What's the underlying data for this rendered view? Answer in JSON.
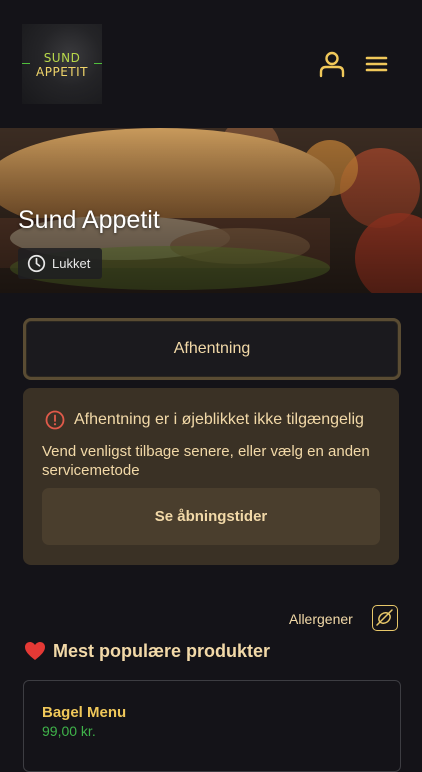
{
  "header": {
    "logo_line1": "SUND",
    "logo_line2": "APPETIT",
    "icons": [
      "user-icon",
      "menu-icon"
    ]
  },
  "hero": {
    "title": "Sund Appetit",
    "status": "Lukket",
    "status_icon": "clock-icon"
  },
  "ordering": {
    "method_label": "Afhentning"
  },
  "notice": {
    "title": "Afhentning er i øjeblikket ikke tilgængelig",
    "body": "Vend venligst tilbage senere, eller vælg en anden servicemetode",
    "hours_button": "Se åbningstider",
    "icon": "alert-circle-icon"
  },
  "allergens": {
    "label": "Allergener",
    "icon": "allergen-icon"
  },
  "popular": {
    "title": "Mest populære produkter",
    "icon": "heart-icon",
    "products": [
      {
        "name": "Bagel Menu",
        "price": "99,00 kr."
      }
    ]
  },
  "colors": {
    "background": "#141318",
    "accent_text": "#f2d9a8",
    "product_name": "#f0c85a",
    "price": "#3fb34a",
    "notice_bg": "#3a3125",
    "alert": "#e05a4a"
  }
}
